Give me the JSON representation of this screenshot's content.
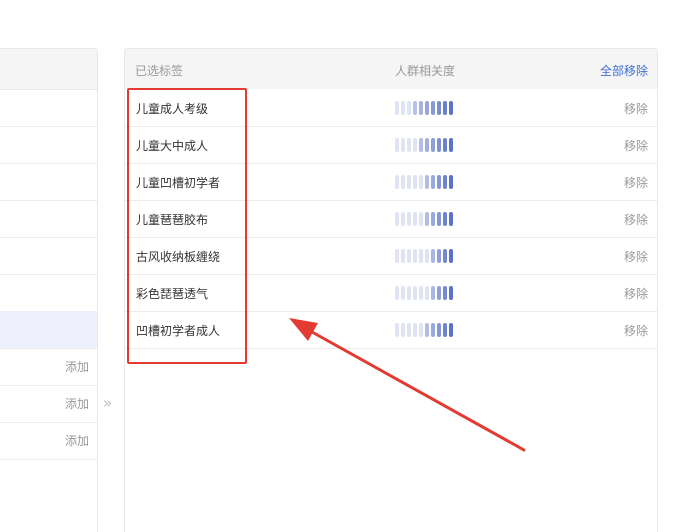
{
  "left_panel": {
    "rows": [
      {
        "add_label": ""
      },
      {
        "add_label": ""
      },
      {
        "add_label": ""
      },
      {
        "add_label": ""
      },
      {
        "add_label": ""
      },
      {
        "add_label": ""
      },
      {
        "add_label": "添加"
      },
      {
        "add_label": "添加"
      },
      {
        "add_label": "添加"
      }
    ]
  },
  "transfer": {
    "arrow_glyph": "»"
  },
  "right_panel": {
    "header": {
      "label": "已选标签",
      "relevance": "人群相关度",
      "remove_all": "全部移除"
    },
    "rows": [
      {
        "name": "儿童成人考级",
        "remove": "移除",
        "relevance_level": 0.7
      },
      {
        "name": "儿童大中成人",
        "remove": "移除",
        "relevance_level": 0.6
      },
      {
        "name": "儿童凹槽初学者",
        "remove": "移除",
        "relevance_level": 0.5
      },
      {
        "name": "儿童琶琶胶布",
        "remove": "移除",
        "relevance_level": 0.5
      },
      {
        "name": "古风收纳板缠绕",
        "remove": "移除",
        "relevance_level": 0.4
      },
      {
        "name": "彩色琵琶透气",
        "remove": "移除",
        "relevance_level": 0.4
      },
      {
        "name": "凹槽初学者成人",
        "remove": "移除",
        "relevance_level": 0.5
      }
    ]
  },
  "colors": {
    "accent": "#3f6fd8",
    "annotation_red": "#e33a32",
    "bar_active": "#5a72c8",
    "bar_inactive": "#dfe3f3"
  }
}
